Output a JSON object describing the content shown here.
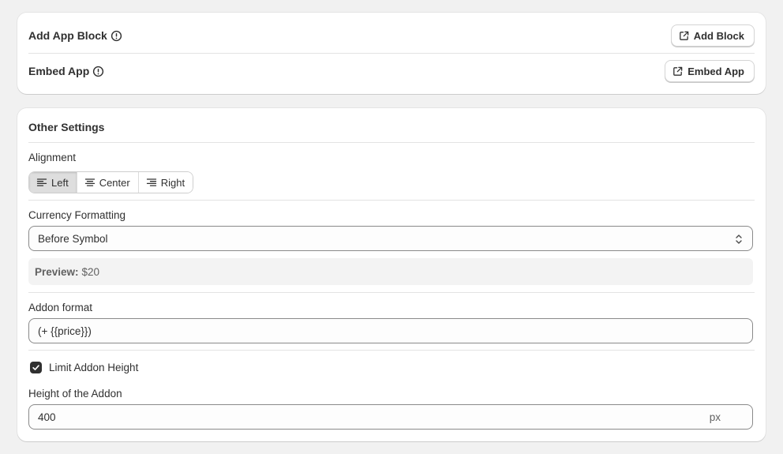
{
  "apps": {
    "add_block_title": "Add App Block",
    "add_block_button": "Add Block",
    "embed_title": "Embed App",
    "embed_button": "Embed App"
  },
  "settings": {
    "title": "Other Settings",
    "alignment": {
      "label": "Alignment",
      "options": [
        "Left",
        "Center",
        "Right"
      ],
      "selected": "Left"
    },
    "currency": {
      "label": "Currency Formatting",
      "value": "Before Symbol",
      "preview_label": "Preview:",
      "preview_value": "$20"
    },
    "addon_format": {
      "label": "Addon format",
      "value": "(+ {{price}})"
    },
    "limit_height": {
      "label": "Limit Addon Height",
      "checked": true
    },
    "addon_height": {
      "label": "Height of the Addon",
      "value": "400",
      "suffix": "px"
    }
  },
  "colors": {
    "background": "#f1f1f1",
    "card": "#ffffff",
    "text": "#303030",
    "segment_active": "#dedede"
  }
}
